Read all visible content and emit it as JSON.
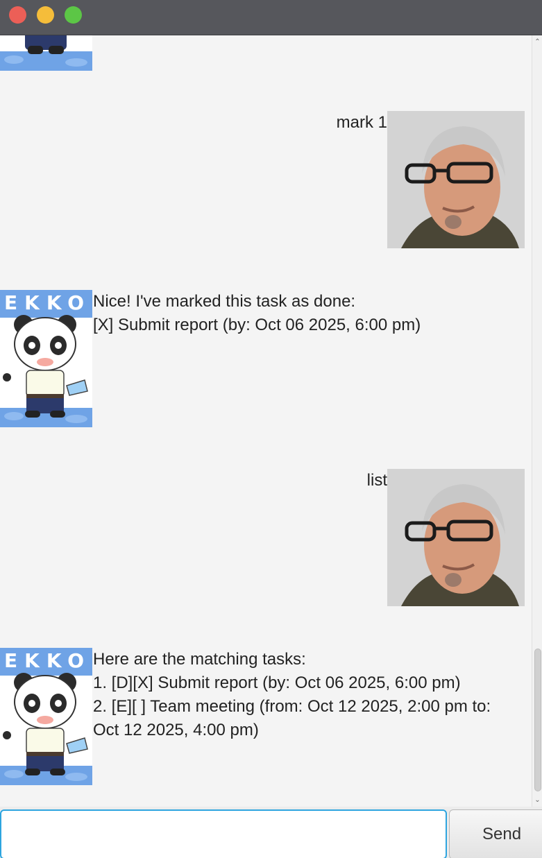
{
  "window": {
    "controls": [
      "close",
      "minimize",
      "maximize"
    ]
  },
  "chat": {
    "bot_avatar_label": "EKKO",
    "messages": [
      {
        "sender": "user",
        "lines": [
          "mark 1"
        ]
      },
      {
        "sender": "bot",
        "lines": [
          "Nice! I've marked this task as done:",
          "[X] Submit report (by: Oct 06 2025, 6:00 pm)"
        ]
      },
      {
        "sender": "user",
        "lines": [
          "list"
        ]
      },
      {
        "sender": "bot",
        "lines": [
          "Here are the matching tasks:",
          "1. [D][X] Submit report (by: Oct 06 2025, 6:00 pm)",
          "2. [E][ ] Team meeting (from: Oct 12 2025, 2:00 pm to:",
          "Oct 12 2025, 4:00 pm)"
        ]
      }
    ]
  },
  "input": {
    "value": "",
    "send_label": "Send"
  },
  "colors": {
    "titlebar": "#56575c",
    "chat_background": "#f4f4f4",
    "input_focus_border": "#2ea5df",
    "close": "#ec5f57",
    "minimize": "#f5bd3a",
    "maximize": "#5cc646"
  }
}
